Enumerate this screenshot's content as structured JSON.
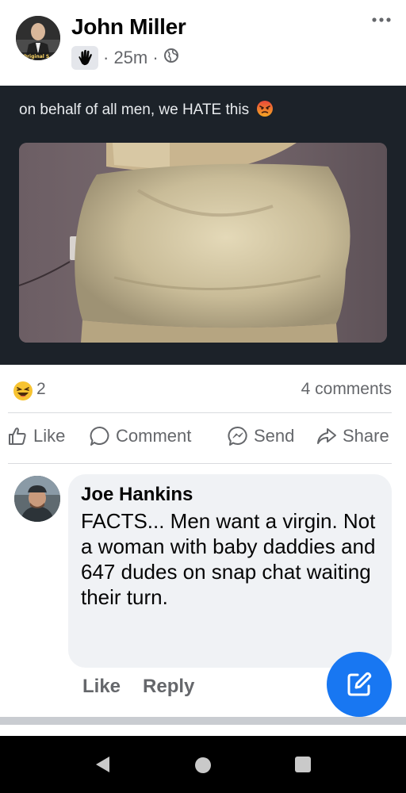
{
  "post": {
    "author_name": "John Miller",
    "avatar_caption": "Original S",
    "time": "· 25m ·",
    "text": "on behalf of all men, we HATE this"
  },
  "stats": {
    "reaction_count": "2",
    "comments": "4 comments"
  },
  "actions": {
    "like": "Like",
    "comment": "Comment",
    "send": "Send",
    "share": "Share"
  },
  "comment": {
    "author": "Joe Hankins",
    "text": "FACTS... Men want a virgin. Not a woman with baby daddies and 647 dudes on snap chat waiting their turn.",
    "like": "Like",
    "reply": "Reply"
  },
  "colors": {
    "accent": "#1877f2",
    "dark_background": "#1c2229",
    "secondary_text": "#65676b",
    "bubble": "#f0f2f5"
  }
}
